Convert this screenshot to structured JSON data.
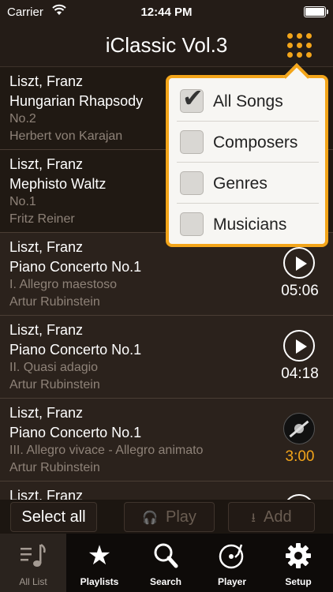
{
  "status": {
    "carrier": "Carrier",
    "time": "12:44 PM"
  },
  "nav": {
    "title": "iClassic Vol.3",
    "menu_icon": "grid-menu-icon"
  },
  "songs": [
    {
      "composer": "Liszt, Franz",
      "title": "Hungarian Rhapsody",
      "part": "No.2",
      "artist": "Herbert von Karajan"
    },
    {
      "composer": "Liszt, Franz",
      "title": "Mephisto Waltz",
      "part": "No.1",
      "artist": "Fritz Reiner"
    },
    {
      "composer": "Liszt, Franz",
      "title": "Piano Concerto No.1",
      "part": "I. Allegro maestoso",
      "artist": "Artur Rubinstein",
      "duration": "05:06"
    },
    {
      "composer": "Liszt, Franz",
      "title": "Piano Concerto No.1",
      "part": "II. Quasi adagio",
      "artist": "Artur Rubinstein",
      "duration": "04:18"
    },
    {
      "composer": "Liszt, Franz",
      "title": "Piano Concerto No.1",
      "part": "III. Allegro vivace - Allegro animato",
      "artist": "Artur Rubinstein",
      "duration": "3:00"
    },
    {
      "composer": "Liszt, Franz"
    }
  ],
  "filter_menu": {
    "options": [
      {
        "label": "All Songs",
        "checked": true
      },
      {
        "label": "Composers",
        "checked": false
      },
      {
        "label": "Genres",
        "checked": false
      },
      {
        "label": "Musicians",
        "checked": false
      }
    ]
  },
  "actions": {
    "select_all": "Select all",
    "play": "Play",
    "add": "Add"
  },
  "tabs": [
    {
      "label": "All List",
      "icon": "music-list-icon"
    },
    {
      "label": "Playlists",
      "icon": "star-icon"
    },
    {
      "label": "Search",
      "icon": "search-icon"
    },
    {
      "label": "Player",
      "icon": "turntable-icon"
    },
    {
      "label": "Setup",
      "icon": "gear-icon"
    }
  ],
  "colors": {
    "accent": "#f3a51a",
    "background": "#2b221c",
    "popover": "#f7f6f3"
  }
}
